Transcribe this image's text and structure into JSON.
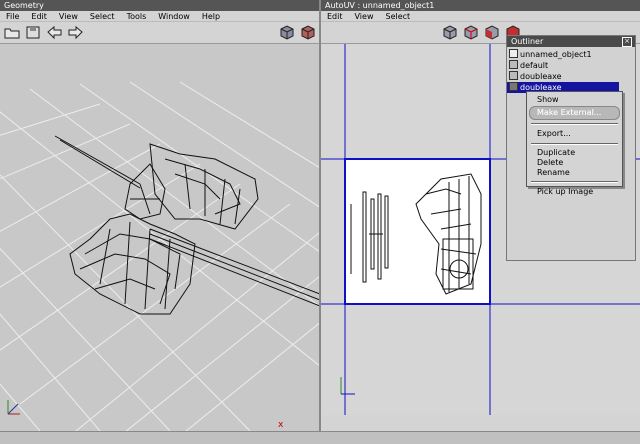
{
  "geometry": {
    "title": "Geometry",
    "menu": [
      "File",
      "Edit",
      "View",
      "Select",
      "Tools",
      "Window",
      "Help"
    ],
    "axis_mark": "x"
  },
  "autouv": {
    "title": "AutoUV : unnamed_object1",
    "menu": [
      "Edit",
      "View",
      "Select"
    ]
  },
  "outliner": {
    "title": "Outliner",
    "items": [
      {
        "label": "unnamed_object1",
        "icon": "object-icon"
      },
      {
        "label": "default",
        "icon": "material-icon"
      },
      {
        "label": "doubleaxe",
        "icon": "material-icon"
      },
      {
        "label": "doubleaxe",
        "icon": "image-icon",
        "selected": true
      }
    ]
  },
  "context_menu": {
    "items": [
      "Show",
      "Make External...",
      "Export...",
      "Duplicate",
      "Delete",
      "Rename",
      "Pick up Image"
    ],
    "highlighted": "Make External..."
  },
  "colors": {
    "accent": "#1010c8",
    "titlebar": "#555555",
    "viewport": "#c8c8c8",
    "selection": "#1414a0"
  }
}
